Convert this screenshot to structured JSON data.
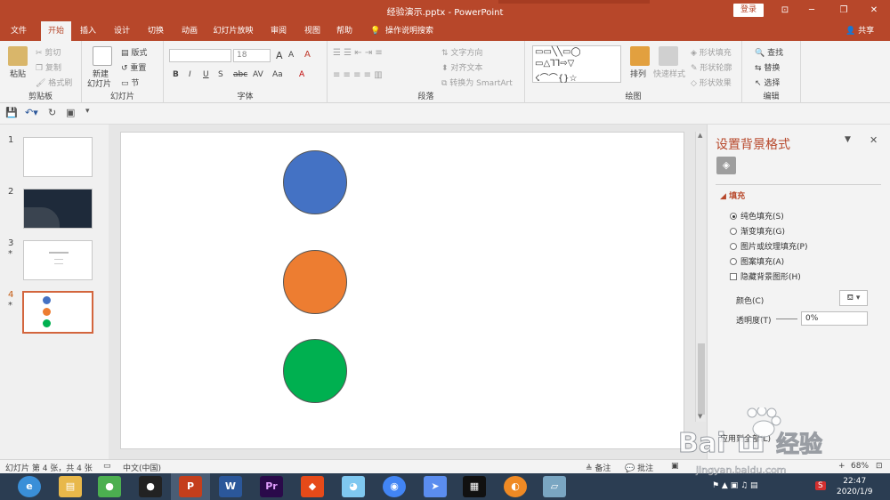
{
  "titlebar": {
    "title": "经验演示.pptx  -  PowerPoint",
    "login": "登录",
    "minimize": "─",
    "restore": "❐",
    "close": "✕",
    "ribbon_display": "⊡"
  },
  "tabs": {
    "file": "文件",
    "home": "开始",
    "insert": "插入",
    "design": "设计",
    "transitions": "切换",
    "animations": "动画",
    "slideshow": "幻灯片放映",
    "review": "审阅",
    "view": "视图",
    "help": "帮助",
    "search": "操作说明搜索",
    "share": "共享"
  },
  "ribbon": {
    "clipboard": {
      "paste": "粘贴",
      "cut": "剪切",
      "copy": "复制",
      "format_painter": "格式刷",
      "label": "剪贴板"
    },
    "slides": {
      "new_slide": "新建",
      "new_slide2": "幻灯片",
      "layout": "版式",
      "reset": "重置",
      "section": "节",
      "label": "幻灯片"
    },
    "font": {
      "font_name": "",
      "font_size": "18",
      "grow": "A",
      "shrink": "A",
      "clear": "A",
      "bold": "B",
      "italic": "I",
      "underline": "U",
      "strike": "S",
      "shadow": "abc",
      "spacing": "AV",
      "case": "Aa",
      "highlight": "A",
      "label": "字体"
    },
    "paragraph": {
      "text_direction": "文字方向",
      "align_text": "对齐文本",
      "smartart": "转换为 SmartArt",
      "label": "段落"
    },
    "drawing": {
      "arrange": "排列",
      "quick_styles": "快速样式",
      "shape_fill": "形状填充",
      "shape_outline": "形状轮廓",
      "shape_effects": "形状效果",
      "label": "绘图"
    },
    "editing": {
      "find": "查找",
      "replace": "替换",
      "select": "选择",
      "label": "编辑"
    }
  },
  "thumbnails": [
    {
      "num": "1",
      "star": ""
    },
    {
      "num": "2",
      "star": ""
    },
    {
      "num": "3",
      "star": "*"
    },
    {
      "num": "4",
      "star": "*"
    }
  ],
  "slide": {
    "circles": [
      {
        "color": "#4472c4"
      },
      {
        "color": "#ed7d31"
      },
      {
        "color": "#00b050"
      }
    ]
  },
  "pane": {
    "title": "设置背景格式",
    "section": "填充",
    "options": [
      "纯色填充(S)",
      "渐变填充(G)",
      "图片或纹理填充(P)",
      "图案填充(A)"
    ],
    "hide_bg": "隐藏背景图形(H)",
    "color_label": "颜色(C)",
    "transparency_label": "透明度(T)",
    "transparency_value": "0%",
    "apply_all": "应用到全部(L)"
  },
  "statusbar": {
    "slide_info": "幻灯片 第 4 张，共 4 张",
    "language": "中文(中国)",
    "notes": "备注",
    "comments": "批注",
    "zoom": "68%"
  },
  "taskbar": {
    "time": "22:47",
    "date": "2020/1/9"
  },
  "colors": {
    "accent": "#b7472a",
    "blue": "#4472c4",
    "orange": "#ed7d31",
    "green": "#00b050"
  }
}
